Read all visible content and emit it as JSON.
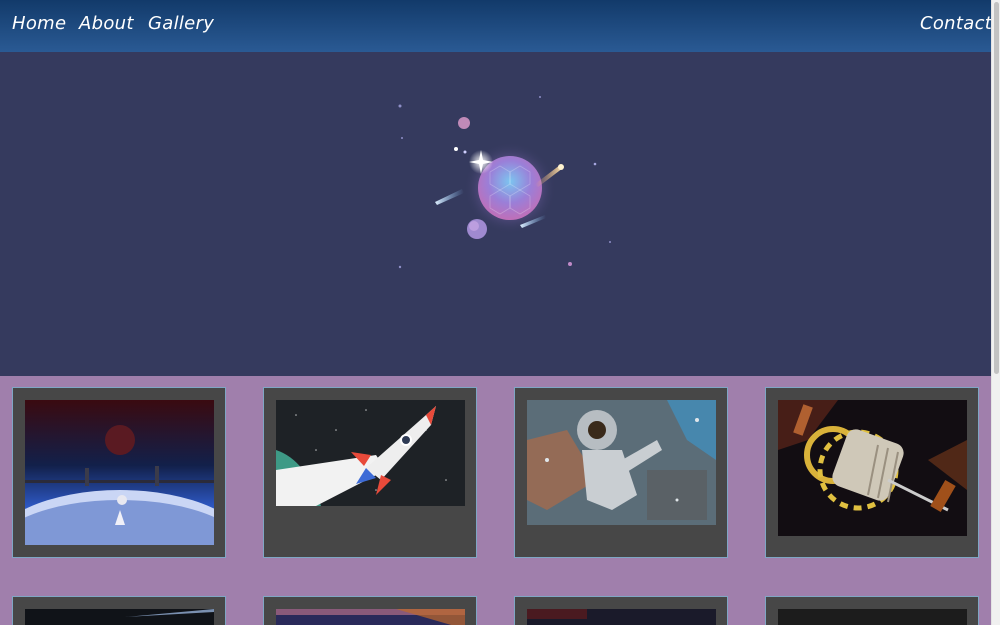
{
  "nav": {
    "home": "Home",
    "about": "About",
    "gallery": "Gallery",
    "contact": "Contact"
  },
  "hero": {
    "illustration": "planet-illustration"
  },
  "gallery": {
    "items": [
      {
        "name": "space-station-earth-image"
      },
      {
        "name": "rocket-launch-image"
      },
      {
        "name": "astronaut-graffiti-image"
      },
      {
        "name": "space-station-ring-image"
      },
      {
        "name": "gallery-image-5"
      },
      {
        "name": "gallery-image-6"
      },
      {
        "name": "gallery-image-7"
      },
      {
        "name": "gallery-image-8"
      }
    ]
  },
  "colors": {
    "nav_top": "#123a6a",
    "nav_bottom": "#2a5a94",
    "hero_bg": "#353a5e",
    "page_bg": "#a07fac",
    "card_bg": "#474747",
    "card_border": "#7fa6c4"
  }
}
